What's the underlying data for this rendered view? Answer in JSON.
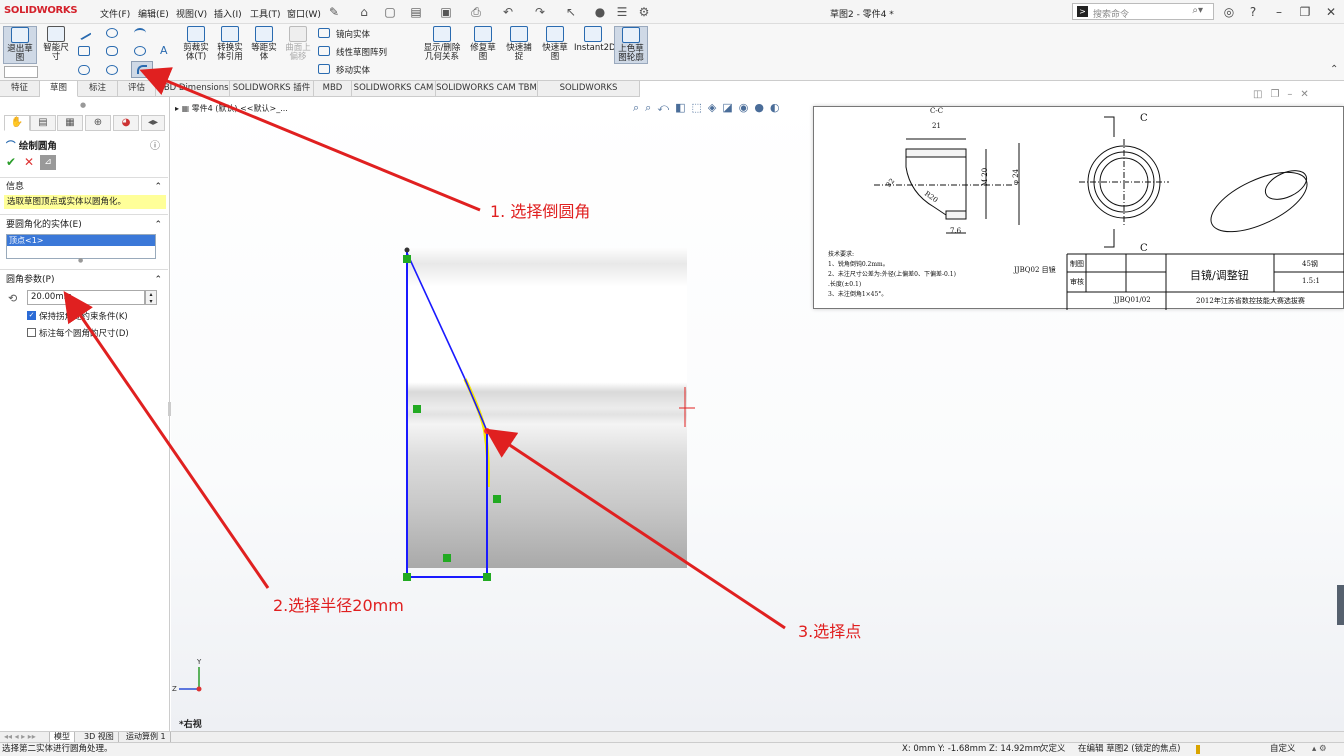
{
  "app": {
    "logo": "SOLIDWORKS",
    "doc_title": "草图2 - 零件4 *",
    "menu": [
      "文件(F)",
      "编辑(E)",
      "视图(V)",
      "插入(I)",
      "工具(T)",
      "窗口(W)"
    ],
    "search_placeholder": "搜索命令"
  },
  "ribbon": {
    "exit_sketch": "退出草图",
    "smart_dim": "智能尺寸",
    "trim": "剪裁实体(T)",
    "convert": "转换实体引用",
    "offset": "等距实体",
    "surface_offset": "曲面上偏移",
    "mirror": "镜向实体",
    "linear_pattern": "线性草图阵列",
    "move": "移动实体",
    "show_delete_relations": "显示/删除几何关系",
    "repair": "修复草图",
    "quick_snap": "快速捕捉",
    "rapid_sketch": "快速草图",
    "instant2d": "Instant2D",
    "shaded_contours": "上色草图轮廓"
  },
  "tabs": [
    "特征",
    "草图",
    "标注",
    "评估",
    "MBD Dimensions",
    "SOLIDWORKS 插件",
    "MBD",
    "SOLIDWORKS CAM",
    "SOLIDWORKS CAM TBM",
    "SOLIDWORKS Inspection"
  ],
  "active_tab": "草图",
  "panel": {
    "title": "绘制圆角",
    "info_head": "信息",
    "info_text": "选取草图顶点或实体以圆角化。",
    "entities_head": "要圆角化的实体(E)",
    "entity_item": "顶点<1>",
    "params_head": "圆角参数(P)",
    "radius": "20.00mm",
    "keep_constraints": "保持拐角处约束条件(K)",
    "dim_each": "标注每个圆角的尺寸(D)"
  },
  "tree": {
    "label": "零件4 (默认) <<默认>_..."
  },
  "view_label": "*右视",
  "bottom_tabs": [
    "模型",
    "3D 视图",
    "运动算例 1"
  ],
  "status": {
    "left": "选择第二实体进行圆角处理。",
    "coords": "X: 0mm Y: -1.68mm Z: 14.92mm",
    "defined": "欠定义",
    "editing": "在编辑 草图2 (锁定的焦点)",
    "custom": "自定义"
  },
  "annotations": {
    "step1": "1. 选择倒圆角",
    "step2": "2.选择半径20mm",
    "step3": "3.选择点"
  },
  "drawing": {
    "section": "C-C",
    "dim21": "21",
    "dimM20": "M 20",
    "dim24": "φ 24",
    "dim76": "7.6",
    "dim32": "32",
    "dimR": "R20",
    "c_top": "C",
    "c_bot": "C",
    "tech_title": "技术要求:",
    "tech1": "1、锐角倒钝0.2mm。",
    "tech2": "2、未注尺寸公差为:外径(上偏差0、下偏差-0.1)",
    "tech3": ".长度(±0.1)",
    "tech4": "3、未注倒角1×45°。",
    "part_no": "JJBQ02 目镜",
    "draw": "制图",
    "check": "审核",
    "name": "目镜/调整钮",
    "material": "45钢",
    "scale": "1.5:1",
    "code": "JJBQ01/02",
    "competition": "2012年江苏省数控技能大赛选拔赛"
  },
  "colors": {
    "arrow": "#e02020",
    "sketch_line": "#1a1aff",
    "selected": "#f5e500",
    "relation": "#22aa22"
  }
}
